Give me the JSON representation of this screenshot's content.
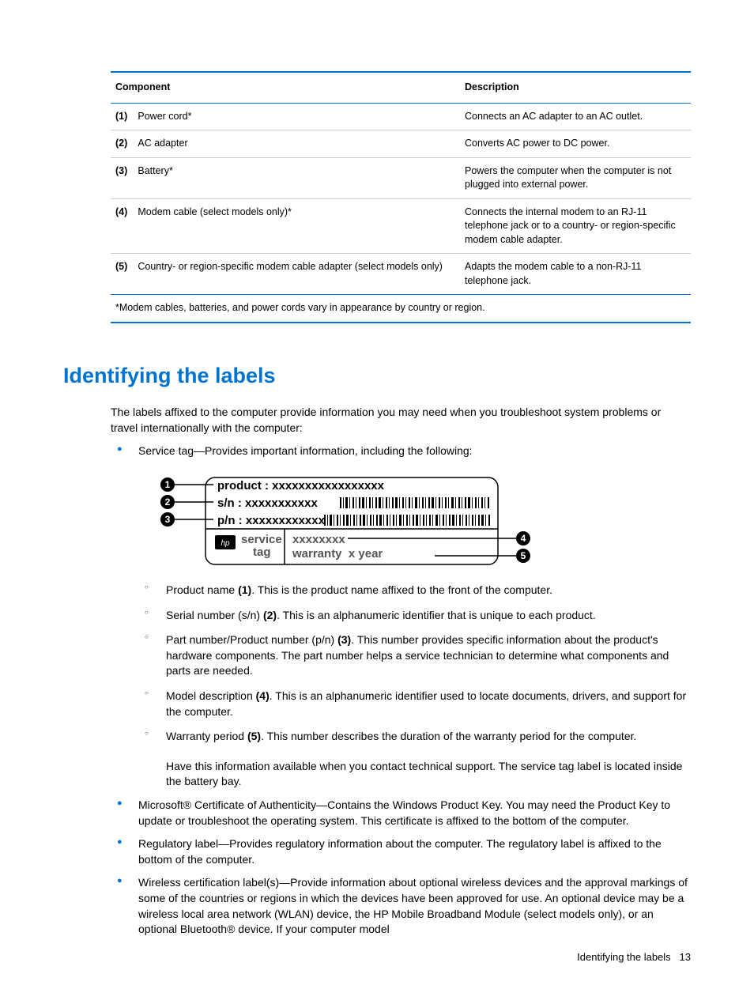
{
  "table": {
    "headers": {
      "component": "Component",
      "description": "Description"
    },
    "rows": [
      {
        "num": "(1)",
        "component": "Power cord*",
        "description": "Connects an AC adapter to an AC outlet."
      },
      {
        "num": "(2)",
        "component": "AC adapter",
        "description": "Converts AC power to DC power."
      },
      {
        "num": "(3)",
        "component": "Battery*",
        "description": "Powers the computer when the computer is not plugged into external power."
      },
      {
        "num": "(4)",
        "component": "Modem cable (select models only)*",
        "description": "Connects the internal modem to an RJ-11 telephone jack or to a country- or region-specific modem cable adapter."
      },
      {
        "num": "(5)",
        "component": "Country- or region-specific modem cable adapter (select models only)",
        "description": "Adapts the modem cable to a non-RJ-11 telephone jack."
      }
    ],
    "footnote": "*Modem cables, batteries, and power cords vary in appearance by country or region."
  },
  "heading": "Identifying the labels",
  "intro": "The labels affixed to the computer provide information you may need when you troubleshoot system problems or travel internationally with the computer:",
  "service_tag_intro": "Service tag—Provides important information, including the following:",
  "diagram": {
    "product_label": "product :",
    "product_value": "xxxxxxxxxxxxxxxxx",
    "sn_label": "s/n :",
    "sn_value": "xxxxxxxxxxx",
    "pn_label": "p/n :",
    "pn_value": "xxxxxxxxxxxx",
    "service": "service",
    "tag": "tag",
    "model": "xxxxxxxx",
    "warranty_label": "warranty",
    "warranty_value": "x year"
  },
  "sublist": [
    {
      "prefix": "Product name ",
      "bold": "(1)",
      "text": ". This is the product name affixed to the front of the computer."
    },
    {
      "prefix": "Serial number (s/n) ",
      "bold": "(2)",
      "text": ". This is an alphanumeric identifier that is unique to each product."
    },
    {
      "prefix": "Part number/Product number (p/n) ",
      "bold": "(3)",
      "text": ". This number provides specific information about the product's hardware components. The part number helps a service technician to determine what components and parts are needed."
    },
    {
      "prefix": "Model description ",
      "bold": "(4)",
      "text": ". This is an alphanumeric identifier used to locate documents, drivers, and support for the computer."
    },
    {
      "prefix": "Warranty period ",
      "bold": "(5)",
      "text": ". This number describes the duration of the warranty period for the computer."
    }
  ],
  "support_text": "Have this information available when you contact technical support. The service tag label is located inside the battery bay.",
  "other_bullets": [
    "Microsoft® Certificate of Authenticity—Contains the Windows Product Key. You may need the Product Key to update or troubleshoot the operating system. This certificate is affixed to the bottom of the computer.",
    "Regulatory label—Provides regulatory information about the computer. The regulatory label is affixed to the bottom of the computer.",
    "Wireless certification label(s)—Provide information about optional wireless devices and the approval markings of some of the countries or regions in which the devices have been approved for use. An optional device may be a wireless local area network (WLAN) device, the HP Mobile Broadband Module (select models only), or an optional Bluetooth® device. If your computer model"
  ],
  "footer": {
    "title": "Identifying the labels",
    "page": "13"
  }
}
